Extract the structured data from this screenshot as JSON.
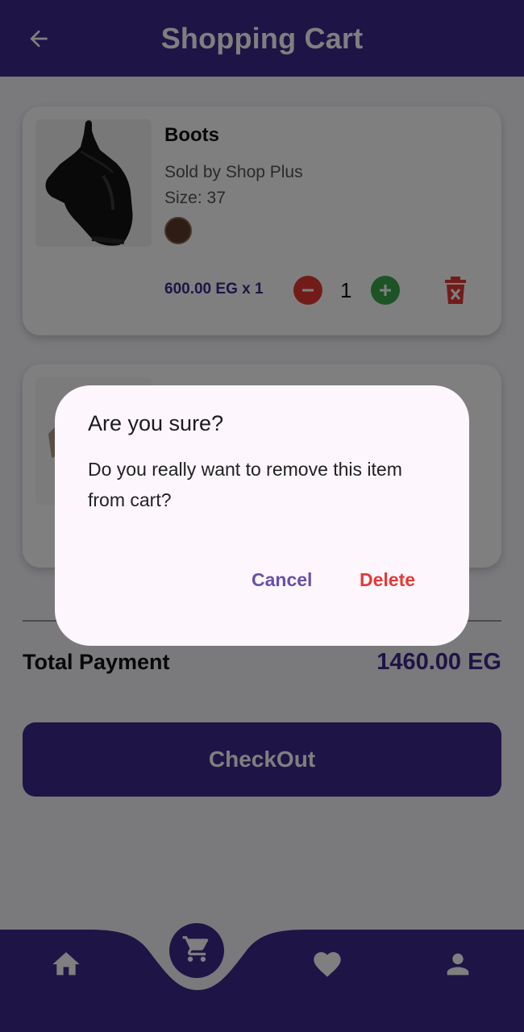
{
  "appbar": {
    "title": "Shopping Cart"
  },
  "cart": {
    "items": [
      {
        "name": "Boots",
        "seller": "Sold by Shop Plus",
        "size": "Size: 37",
        "color": "#5a3a2a",
        "price_line": "600.00 EG x 1",
        "quantity": "1"
      },
      {
        "name": "",
        "seller": "",
        "size": "",
        "color": "",
        "price_line": "",
        "quantity": ""
      }
    ]
  },
  "summary": {
    "total_label": "Total Payment",
    "total_value": "1460.00 EG"
  },
  "checkout": {
    "label": "CheckOut"
  },
  "dialog": {
    "title": "Are you sure?",
    "message": "Do you really want to remove this item from cart?",
    "cancel_label": "Cancel",
    "delete_label": "Delete"
  },
  "colors": {
    "primary": "#3f288c",
    "danger": "#e53935",
    "success": "#3aa84a",
    "dialog_bg": "#fdf6fd"
  },
  "nav": {
    "items": [
      "home-icon",
      "cart-icon",
      "heart-icon",
      "person-icon"
    ]
  }
}
